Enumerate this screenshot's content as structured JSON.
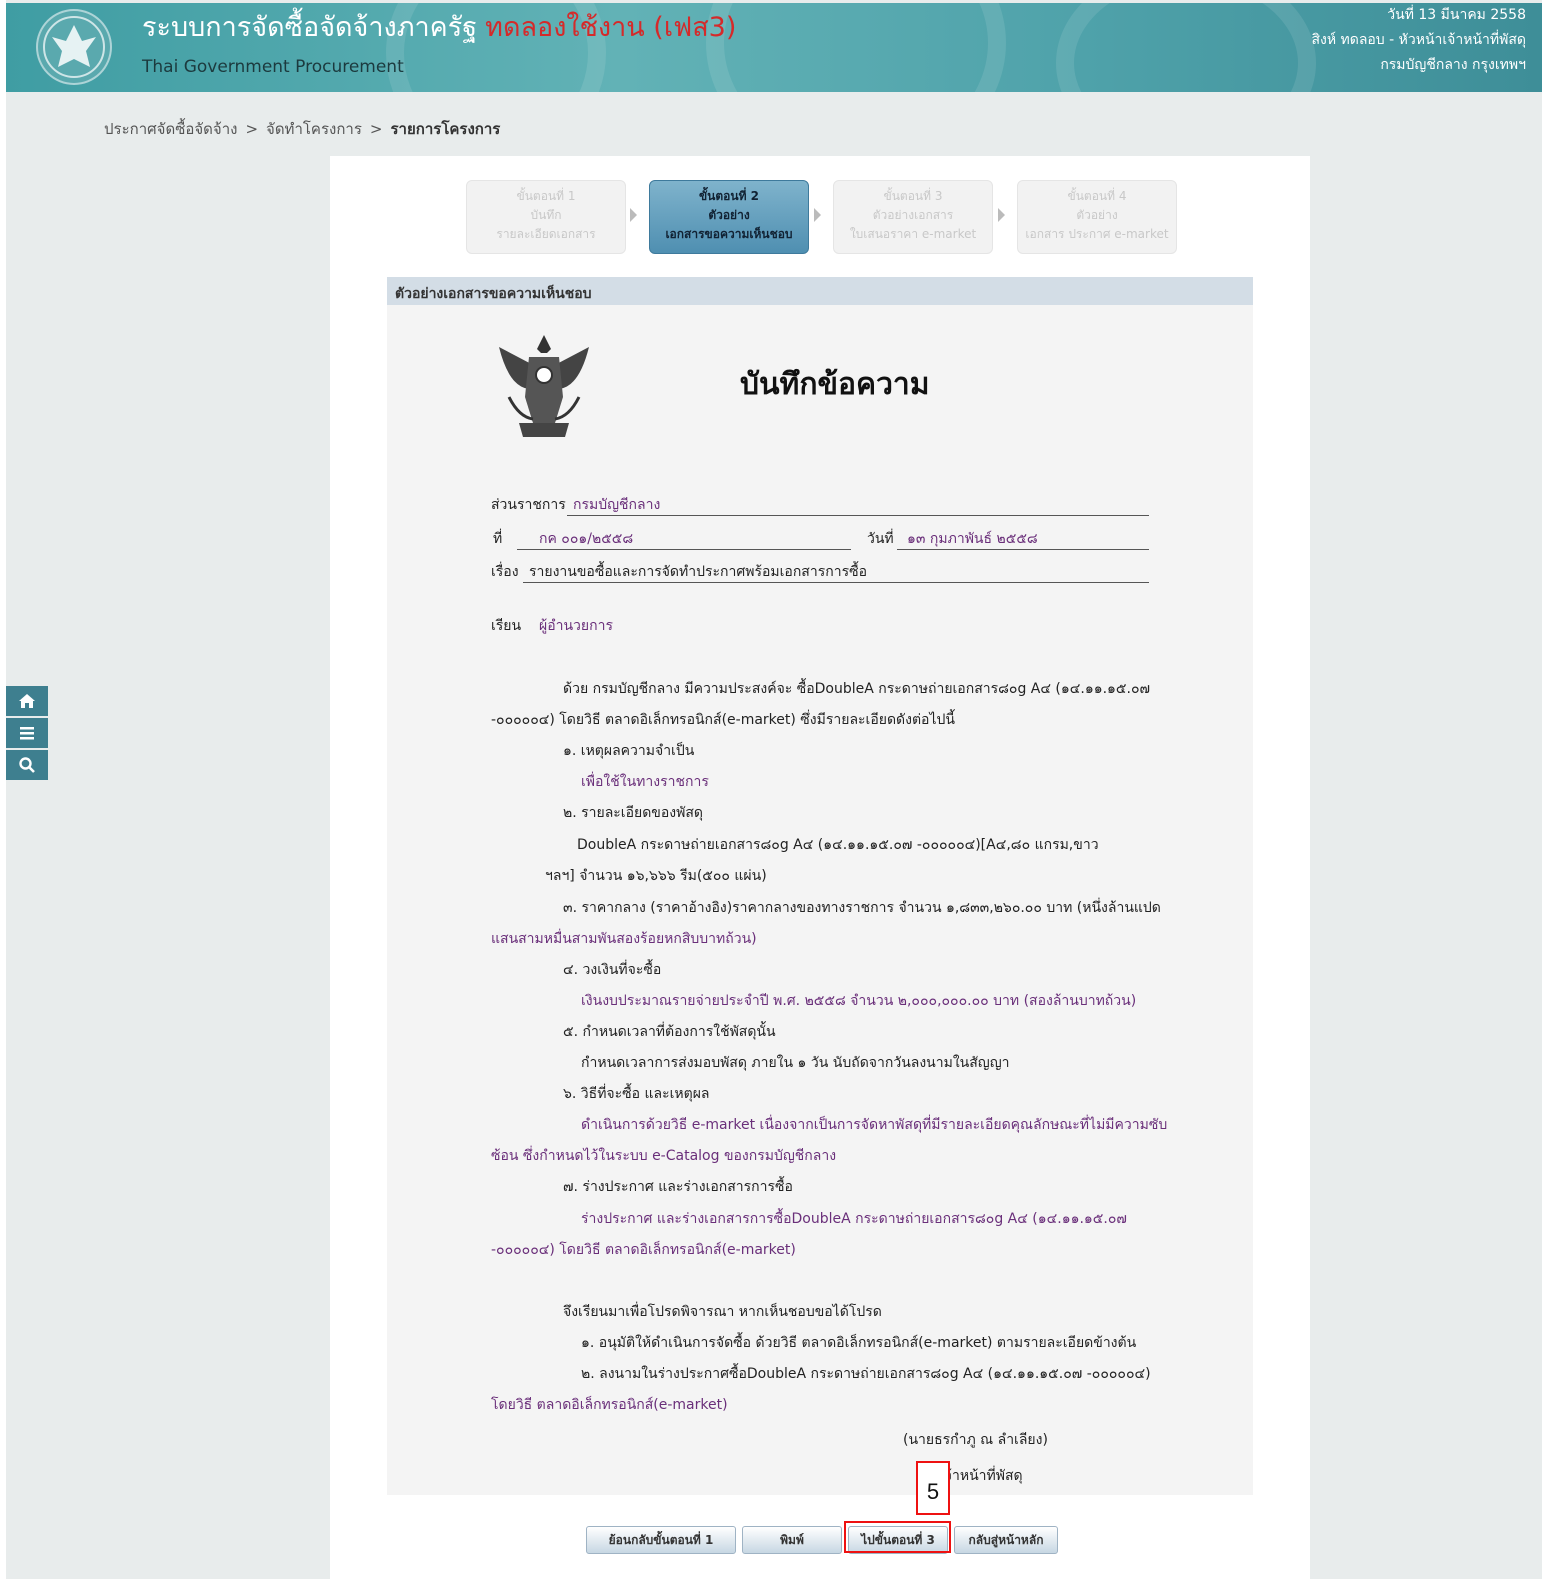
{
  "header": {
    "title": "ระบบการจัดซื้อจัดจ้างภาครัฐ",
    "trial_label": "ทดลองใช้งาน (เฟส3)",
    "subtitle": "Thai Government Procurement",
    "date": "วันที่ 13 มีนาคม 2558",
    "user": "สิงห์ ทดลอบ - หัวหน้าเจ้าหน้าที่พัสดุ",
    "department": "กรมบัญชีกลาง กรุงเทพฯ",
    "logo_icon": "garuda-seal-icon"
  },
  "breadcrumb": {
    "items": [
      "ประกาศจัดซื้อจัดจ้าง",
      "จัดทำโครงการ",
      "รายการโครงการ"
    ],
    "separator": ">"
  },
  "side_tools": {
    "icons": [
      "home-icon",
      "menu-icon",
      "search-icon"
    ]
  },
  "steps": [
    {
      "line1": "ขั้นตอนที่ 1",
      "line2": "บันทึก",
      "line3": "รายละเอียดเอกสาร"
    },
    {
      "line1": "ขั้นตอนที่ 2",
      "line2": "ตัวอย่าง",
      "line3": "เอกสารขอความเห็นชอบ"
    },
    {
      "line1": "ขั้นตอนที่ 3",
      "line2": "ตัวอย่างเอกสาร",
      "line3": "ใบเสนอราคา e-market"
    },
    {
      "line1": "ขั้นตอนที่ 4",
      "line2": "ตัวอย่าง",
      "line3": "เอกสาร ประกาศ e-market"
    }
  ],
  "section_title": "ตัวอย่างเอกสารขอความเห็นชอบ",
  "memo": {
    "title": "บันทึกข้อความ",
    "agency_label": "ส่วนราชการ",
    "agency": "กรมบัญชีกลาง",
    "no_label": "ที่",
    "no": "กค ๐๐๑/๒๕๕๘",
    "date_label": "วันที่",
    "date": "๑๓ กุมภาพันธ์ ๒๕๕๘",
    "subject_label": "เรื่อง",
    "subject": "รายงานขอซื้อและการจัดทำประกาศพร้อมเอกสารการซื้อ",
    "to_label": "เรียน",
    "to": "ผู้อำนวยการ",
    "body": [
      "ด้วย กรมบัญชีกลาง มีความประสงค์จะ ซื้อDoubleA กระดาษถ่ายเอกสาร๘๐g A๔ (๑๔.๑๑.๑๕.๐๗",
      "-๐๐๐๐๐๔) โดยวิธี ตลาดอิเล็กทรอนิกส์(e-market) ซึ่งมีรายละเอียดดังต่อไปนี้",
      "๑. เหตุผลความจำเป็น",
      "เพื่อใช้ในทางราชการ",
      "๒. รายละเอียดของพัสดุ",
      "DoubleA กระดาษถ่ายเอกสาร๘๐g A๔ (๑๔.๑๑.๑๕.๐๗ -๐๐๐๐๐๔)[A๔,๘๐ แกรม,ขาว",
      "ฯลฯ] จำนวน ๑๖,๖๖๖ รีม(๕๐๐ แผ่น)",
      "๓. ราคากลาง (ราคาอ้างอิง)ราคากลางของทางราชการ จำนวน ๑,๘๓๓,๒๖๐.๐๐ บาท (หนึ่งล้านแปด",
      "แสนสามหมื่นสามพันสองร้อยหกสิบบาทถ้วน)",
      "๔. วงเงินที่จะซื้อ",
      "เงินงบประมาณรายจ่ายประจำปี พ.ศ. ๒๕๕๘ จำนวน ๒,๐๐๐,๐๐๐.๐๐ บาท (สองล้านบาทถ้วน)",
      "๕. กำหนดเวลาที่ต้องการใช้พัสดุนั้น",
      "กำหนดเวลาการส่งมอบพัสดุ ภายใน ๑ วัน นับถัดจากวันลงนามในสัญญา",
      "๖. วิธีที่จะซื้อ และเหตุผล",
      "ดำเนินการด้วยวิธี e-market เนื่องจากเป็นการจัดหาพัสดุที่มีรายละเอียดคุณลักษณะที่ไม่มีความซับ",
      "ซ้อน ซึ่งกำหนดไว้ในระบบ e-Catalog ของกรมบัญชีกลาง",
      "๗. ร่างประกาศ และร่างเอกสารการซื้อ",
      "ร่างประกาศ และร่างเอกสารการซื้อDoubleA กระดาษถ่ายเอกสาร๘๐g A๔ (๑๔.๑๑.๑๕.๐๗",
      "-๐๐๐๐๐๔) โดยวิธี ตลาดอิเล็กทรอนิกส์(e-market)",
      "จึงเรียนมาเพื่อโปรดพิจารณา หากเห็นชอบขอได้โปรด",
      "๑. อนุมัติให้ดำเนินการจัดซื้อ ด้วยวิธี ตลาดอิเล็กทรอนิกส์(e-market) ตามรายละเอียดข้างต้น",
      "๒. ลงนามในร่างประกาศซื้อDoubleA กระดาษถ่ายเอกสาร๘๐g A๔ (๑๔.๑๑.๑๕.๐๗ -๐๐๐๐๐๔)",
      "โดยวิธี ตลาดอิเล็กทรอนิกส์(e-market)"
    ],
    "signer": "(นายธรกำภู ณ ลำเลียง)",
    "signer_title": "เจ้าหน้าที่พัสดุ"
  },
  "buttons": {
    "back": "ย้อนกลับขั้นตอนที่ 1",
    "print": "พิมพ์",
    "next": "ไปขั้นตอนที่ 3",
    "home": "กลับสู่หน้าหลัก"
  },
  "annotation": {
    "label": "5",
    "color": "#e11111"
  }
}
